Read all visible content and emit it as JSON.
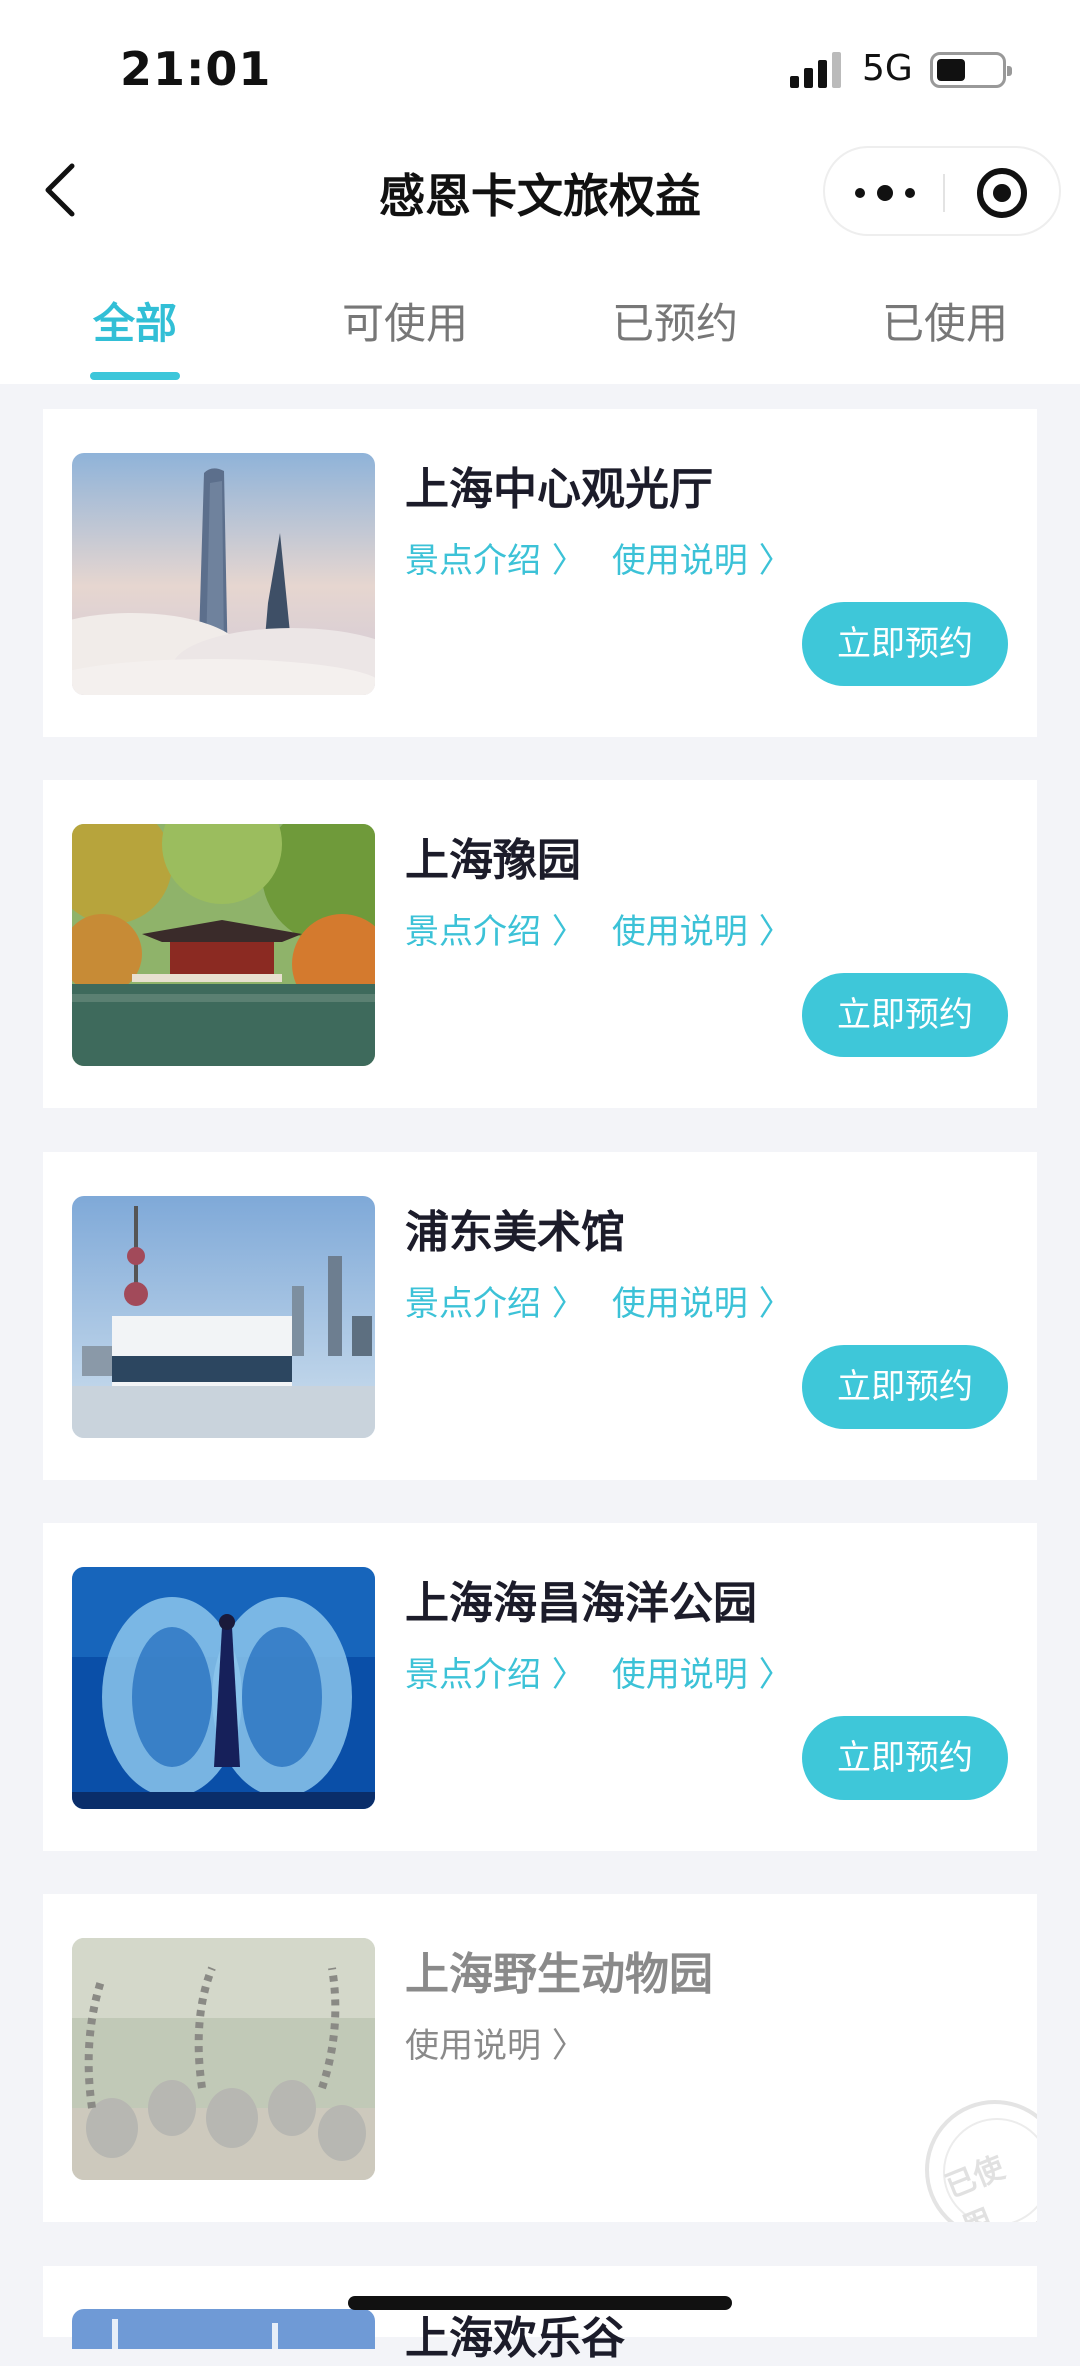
{
  "status_bar": {
    "time": "21:01",
    "network": "5G"
  },
  "nav": {
    "title": "感恩卡文旅权益"
  },
  "tabs": [
    {
      "label": "全部",
      "active": true
    },
    {
      "label": "可使用",
      "active": false
    },
    {
      "label": "已预约",
      "active": false
    },
    {
      "label": "已使用",
      "active": false
    }
  ],
  "cards": [
    {
      "name": "上海中心观光厅",
      "intro": "景点介绍 〉",
      "usage": "使用说明 〉",
      "button": "立即预约",
      "image": "skyscraper-in-clouds-photo"
    },
    {
      "name": "上海豫园",
      "intro": "景点介绍 〉",
      "usage": "使用说明 〉",
      "button": "立即预约",
      "image": "garden-pavilion-photo"
    },
    {
      "name": "浦东美术馆",
      "intro": "景点介绍 〉",
      "usage": "使用说明 〉",
      "button": "立即预约",
      "image": "museum-skyline-photo"
    },
    {
      "name": "上海海昌海洋公园",
      "intro": "景点介绍 〉",
      "usage": "使用说明 〉",
      "button": "立即预约",
      "image": "beluga-aquarium-photo"
    },
    {
      "name": "上海野生动物园",
      "usage": "使用说明 〉",
      "stamp": "已使用",
      "image": "lemurs-photo"
    },
    {
      "name": "上海欢乐谷",
      "image": "amusement-park-photo"
    }
  ],
  "colors": {
    "accent": "#3ec7d9",
    "background": "#f3f4f8"
  }
}
